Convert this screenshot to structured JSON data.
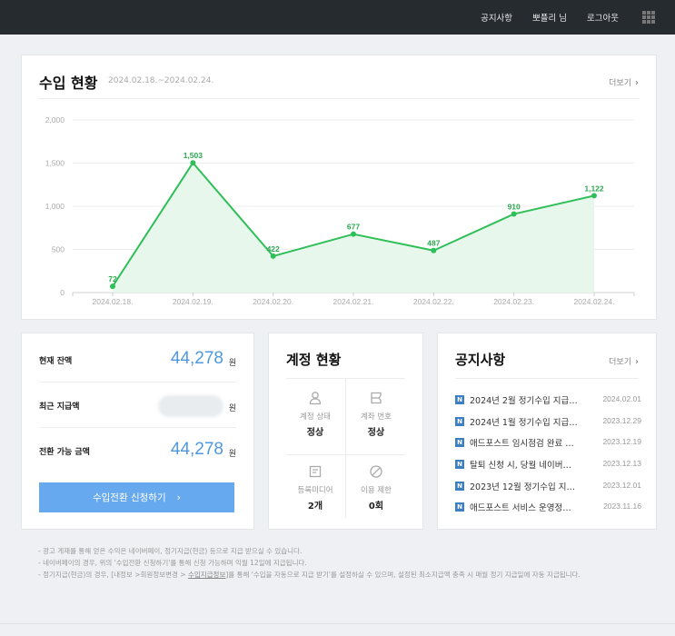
{
  "topbar": {
    "links": [
      "공지사항",
      "뽀플리 님",
      "로그아웃"
    ]
  },
  "revenue": {
    "title": "수입 현황",
    "period": "2024.02.18.~2024.02.24.",
    "more_label": "더보기",
    "line_color": "#2fbf58",
    "fill_color": "#e8f7ec"
  },
  "chart_data": {
    "type": "area",
    "categories": [
      "2024.02.18.",
      "2024.02.19.",
      "2024.02.20.",
      "2024.02.21.",
      "2024.02.22.",
      "2024.02.23.",
      "2024.02.24."
    ],
    "values": [
      72,
      1503,
      422,
      677,
      487,
      910,
      1122
    ],
    "value_labels": [
      "72",
      "1,503",
      "422",
      "677",
      "487",
      "910",
      "1,122"
    ],
    "y_ticks": [
      0,
      500,
      1000,
      1500,
      2000
    ],
    "y_tick_labels": [
      "0",
      "500",
      "1,000",
      "1,500",
      "2,000"
    ],
    "ylim": [
      0,
      2000
    ],
    "grid": true
  },
  "balance": {
    "current_label": "현재 잔액",
    "current_value": "44,278",
    "recent_label": "최근 지급액",
    "convertible_label": "전환 가능 금액",
    "convertible_value": "44,278",
    "unit": "원",
    "button_label": "수입전환 신청하기"
  },
  "account": {
    "title": "계정 현황",
    "cells": [
      {
        "icon": "person-icon",
        "label": "계정 상태",
        "value": "정상"
      },
      {
        "icon": "bank-icon",
        "label": "계좌 번호",
        "value": "정상"
      },
      {
        "icon": "media-icon",
        "label": "등록미디어",
        "value": "2개"
      },
      {
        "icon": "restriction-icon",
        "label": "이용 제한",
        "value": "0회"
      }
    ]
  },
  "notices": {
    "title": "공지사항",
    "more_label": "더보기",
    "badge": "N",
    "items": [
      {
        "text": "2024년 2월 정기수입 지급 ...",
        "date": "2024.02.01"
      },
      {
        "text": "2024년 1월 정기수입 지급 ...",
        "date": "2023.12.29"
      },
      {
        "text": "애드포스트 임시점검 완료 안...",
        "date": "2023.12.19"
      },
      {
        "text": "탈퇴 신청 시, 당월 네이버페...",
        "date": "2023.12.13"
      },
      {
        "text": "2023년 12월 정기수입 지급...",
        "date": "2023.12.01"
      },
      {
        "text": "애드포스트 서비스 운영정책 ...",
        "date": "2023.11.16"
      }
    ]
  },
  "footnotes": {
    "line1": "- 광고 게재를 통해 얻은 수익은 네이버페이, 정기지급(현금) 등으로 지급 받으실 수 있습니다.",
    "line2": "- 네이버페이의 경우, 위의 '수입전환 신청하기'를 통해 신청 가능하며 익월 12일에 지급됩니다.",
    "line3_pre": "- 정기지급(현금)의 경우, [내정보 >회원정보변경 > ",
    "line3_link": "수입지급정보",
    "line3_post": "]를 통해 '수입을 자동으로 지급 받기'를 설정하실 수 있으며, 설정된 최소지급액 충족 시 매월 정기 지급일에 자동 지급됩니다."
  }
}
